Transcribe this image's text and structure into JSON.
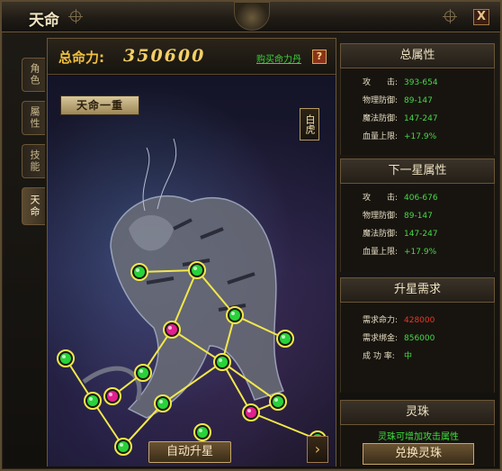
{
  "window": {
    "title": "天命",
    "close_label": "X"
  },
  "tabs": [
    {
      "label": "角色",
      "active": false
    },
    {
      "label": "屬性",
      "active": false
    },
    {
      "label": "技能",
      "active": false
    },
    {
      "label": "天命",
      "active": true
    }
  ],
  "power": {
    "label": "总命力:",
    "value": "350600",
    "buy_link": "购买命力丹",
    "help": "?"
  },
  "constellation": {
    "stage_label": "天命一重",
    "beast_label": "白虎",
    "auto_button": "自动升星",
    "arrow": "›",
    "nodes": [
      {
        "id": 1,
        "color": "green"
      },
      {
        "id": 2,
        "color": "green"
      },
      {
        "id": 3,
        "color": "green"
      },
      {
        "id": 4,
        "color": "green"
      },
      {
        "id": 5,
        "color": "magenta"
      },
      {
        "id": 6,
        "color": "green"
      },
      {
        "id": 7,
        "color": "green"
      },
      {
        "id": 8,
        "color": "magenta"
      },
      {
        "id": 9,
        "color": "green"
      },
      {
        "id": 10,
        "color": "green"
      },
      {
        "id": 11,
        "color": "green"
      },
      {
        "id": 12,
        "color": "green"
      },
      {
        "id": 13,
        "color": "magenta"
      },
      {
        "id": 14,
        "color": "green"
      },
      {
        "id": 15,
        "color": "green"
      },
      {
        "id": 16,
        "color": "green"
      }
    ]
  },
  "total_attr": {
    "header": "总属性",
    "rows": [
      {
        "key": "攻　　击:",
        "value": "393-654"
      },
      {
        "key": "物理防御:",
        "value": "89-147"
      },
      {
        "key": "魔法防御:",
        "value": "147-247"
      },
      {
        "key": "血量上限:",
        "value": "+17.9%"
      }
    ]
  },
  "next_attr": {
    "header": "下一星属性",
    "rows": [
      {
        "key": "攻　　击:",
        "value": "406-676"
      },
      {
        "key": "物理防御:",
        "value": "89-147"
      },
      {
        "key": "魔法防御:",
        "value": "147-247"
      },
      {
        "key": "血量上限:",
        "value": "+17.9%"
      }
    ]
  },
  "upgrade_req": {
    "header": "升星需求",
    "rows": [
      {
        "key": "需求命力:",
        "value": "428000",
        "color": "#e23a2a"
      },
      {
        "key": "需求绑金:",
        "value": "856000",
        "color": "#48d848"
      },
      {
        "key": "成 功 率:",
        "value": "中",
        "color": "#48d848"
      }
    ]
  },
  "spirit_orb": {
    "header": "灵珠",
    "description": "灵珠可增加攻击属性",
    "exchange_button": "兑换灵珠"
  }
}
